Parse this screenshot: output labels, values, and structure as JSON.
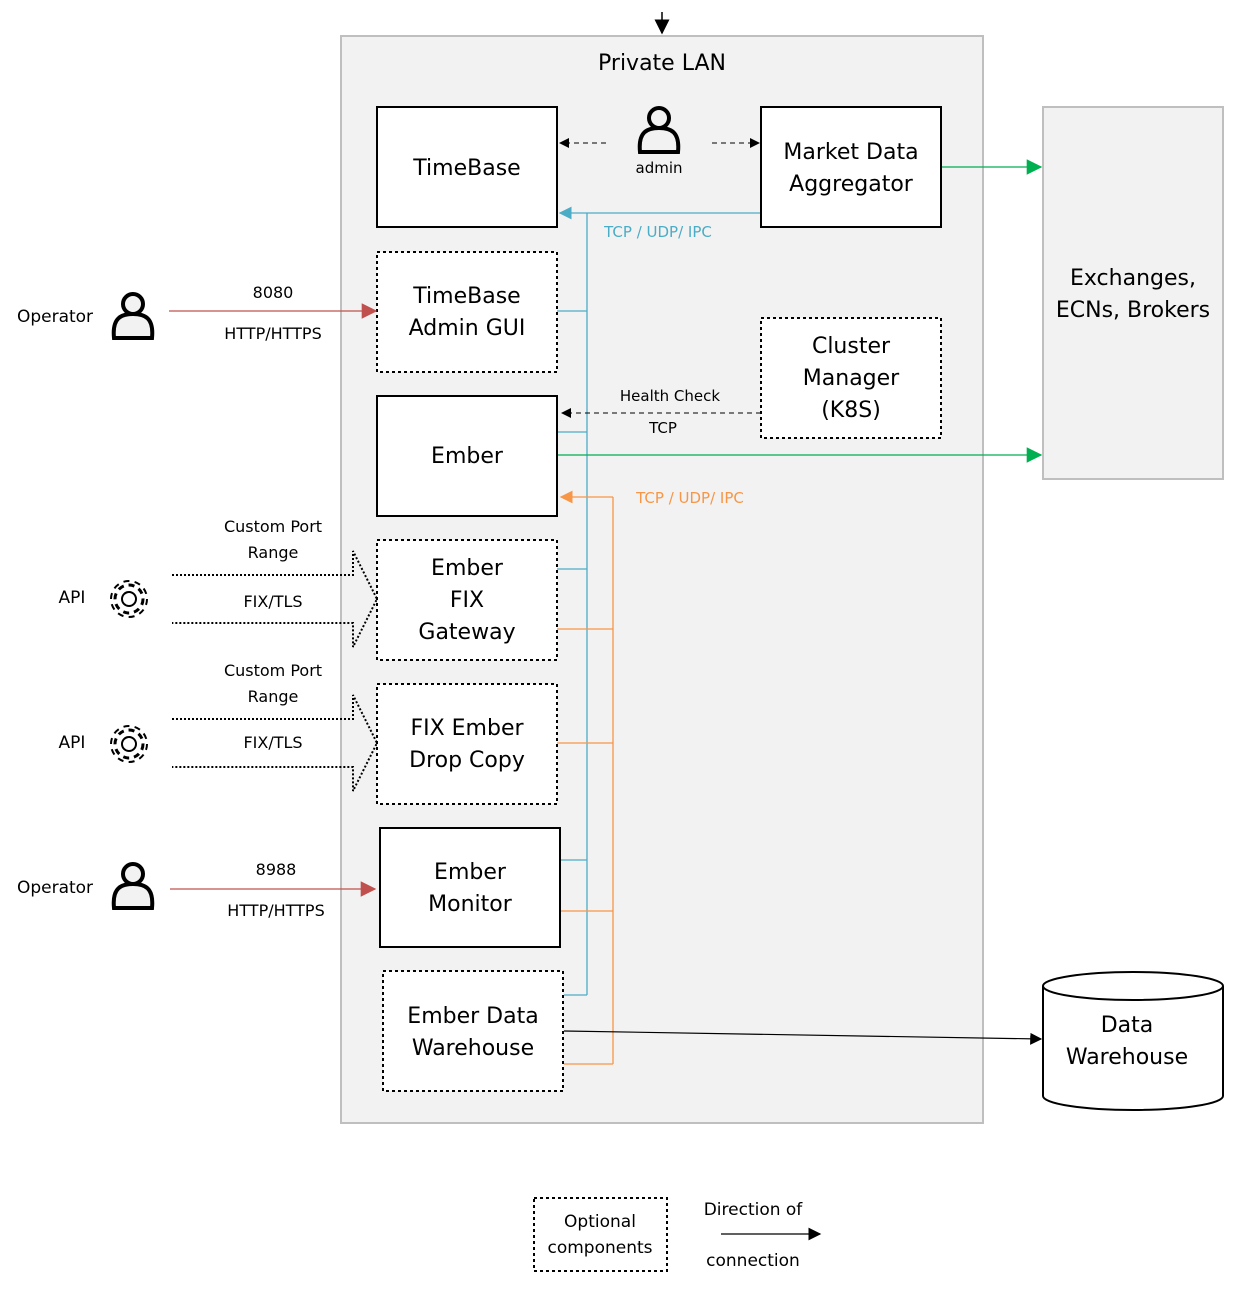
{
  "colors": {
    "blue": "#4bacc6",
    "orange": "#f79646",
    "green": "#00b050",
    "red": "#c0504d",
    "lan_bg": "#f2f2f2"
  },
  "lan": {
    "title": "Private LAN"
  },
  "nodes": {
    "timebase": [
      "TimeBase"
    ],
    "admin_gui": [
      "TimeBase",
      "Admin GUI"
    ],
    "ember": [
      "Ember"
    ],
    "fix_gateway": [
      "Ember",
      "FIX",
      "Gateway"
    ],
    "drop_copy": [
      "FIX Ember",
      "Drop Copy"
    ],
    "monitor": [
      "Ember",
      "Monitor"
    ],
    "data_warehouse_ember": [
      "Ember Data",
      "Warehouse"
    ],
    "market_data": [
      "Market Data",
      "Aggregator"
    ],
    "cluster_manager": [
      "Cluster",
      "Manager",
      "(K8S)"
    ],
    "exchanges": [
      "Exchanges,",
      "ECNs, Brokers"
    ],
    "data_warehouse": [
      "Data",
      "Warehouse"
    ]
  },
  "actors": {
    "admin": "admin",
    "operator1": "Operator",
    "operator2": "Operator",
    "api1": "API",
    "api2": "API"
  },
  "connections": {
    "blue_label": "TCP / UDP/ IPC",
    "orange_label": "TCP / UDP/ IPC",
    "health_check": "Health Check",
    "health_tcp": "TCP",
    "op1_port": "8080",
    "op1_proto": "HTTP/HTTPS",
    "op2_port": "8988",
    "op2_proto": "HTTP/HTTPS",
    "api1_range": [
      "Custom Port",
      "Range"
    ],
    "api1_proto": "FIX/TLS",
    "api2_range": [
      "Custom Port",
      "Range"
    ],
    "api2_proto": "FIX/TLS"
  },
  "legend": {
    "optional": [
      "Optional",
      "components"
    ],
    "direction": [
      "Direction of",
      "connection"
    ]
  }
}
